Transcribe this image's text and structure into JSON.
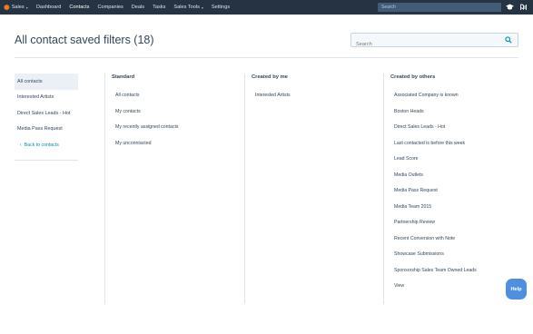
{
  "nav": {
    "brand_label": "Sales",
    "items": [
      {
        "label": "Dashboard",
        "active": false,
        "dropdown": false
      },
      {
        "label": "Contacts",
        "active": true,
        "dropdown": false
      },
      {
        "label": "Companies",
        "active": false,
        "dropdown": false
      },
      {
        "label": "Deals",
        "active": false,
        "dropdown": false
      },
      {
        "label": "Tasks",
        "active": false,
        "dropdown": false
      },
      {
        "label": "Sales Tools",
        "active": false,
        "dropdown": true
      },
      {
        "label": "Settings",
        "active": false,
        "dropdown": false
      }
    ],
    "search_placeholder": "Search",
    "icons": [
      "graduation-cap-icon",
      "notifications-icon"
    ]
  },
  "header": {
    "title": "All contact saved filters (18)",
    "search_placeholder": "Search"
  },
  "sidebar": {
    "items": [
      {
        "label": "All contacts",
        "selected": true
      },
      {
        "label": "Interested Artists",
        "selected": false
      },
      {
        "label": "Direct Sales Leads - Hot",
        "selected": false
      },
      {
        "label": "Media Pass Request",
        "selected": false
      }
    ],
    "back_label": "Back to contacts"
  },
  "columns": {
    "standard": {
      "heading": "Standard",
      "items": [
        "All contacts",
        "My contacts",
        "My recently assigned contacts",
        "My unconntacted"
      ]
    },
    "created_by_me": {
      "heading": "Created by me",
      "items": [
        "Interested Artists"
      ]
    },
    "created_by_others": {
      "heading": "Created by others",
      "items": [
        "Associated Company is known",
        "Boston Heads",
        "Direct Sales Leads - Hot",
        "Last contacted is before this week",
        "Lead Score",
        "Media Outlets",
        "Media Pass Request",
        "Media Team 2015",
        "Partnership Review",
        "Recent Conversion with Note",
        "Showcase Submissions",
        "Sponsorship Sales Team Owned Leads",
        "View"
      ]
    }
  },
  "help": {
    "label": "Help"
  },
  "colors": {
    "nav_bg": "#253342",
    "brand_orange": "#f57722",
    "link": "#0091ae",
    "help_button": "#4f8fdf",
    "selected_bg": "#eaf0f6"
  }
}
